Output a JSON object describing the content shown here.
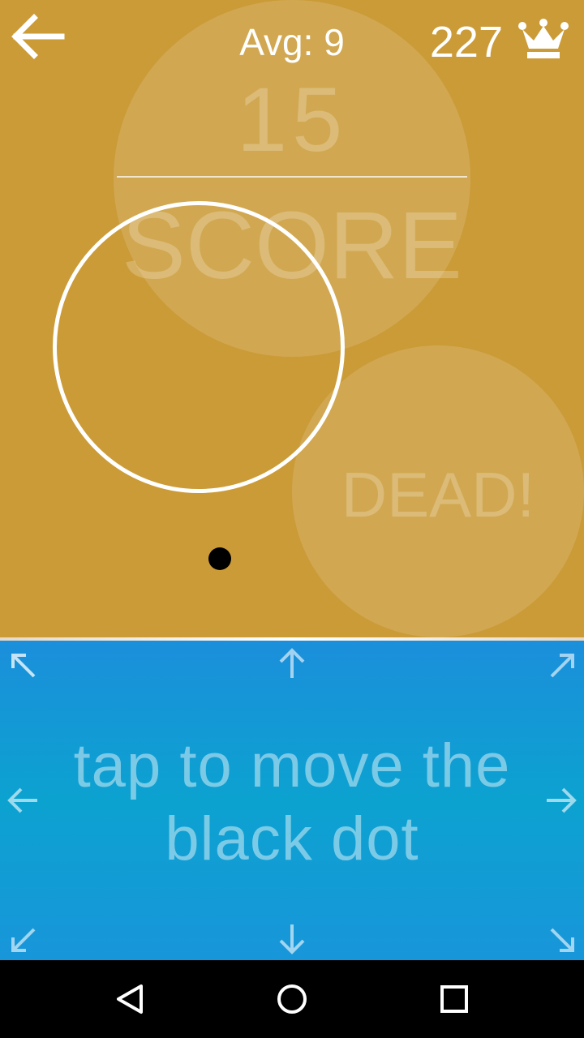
{
  "header": {
    "back_icon": "arrow-left-icon",
    "avg_text": "Avg: 9",
    "best_score": "227",
    "best_icon": "crown-icon"
  },
  "board": {
    "score_value": "15",
    "score_label": "SCORE",
    "dead_label": "DEAD!"
  },
  "controls": {
    "hint": "tap to move the black dot",
    "arrows": [
      "up-left",
      "up",
      "up-right",
      "left",
      "right",
      "down-left",
      "down",
      "down-right"
    ]
  },
  "navigation": {
    "buttons": [
      "back-triangle-icon",
      "home-circle-icon",
      "recents-square-icon"
    ]
  },
  "colors": {
    "game_background": "#cb9b38",
    "control_background": "#1b8fdb",
    "ring": "#ffffff",
    "dot": "#000000"
  }
}
